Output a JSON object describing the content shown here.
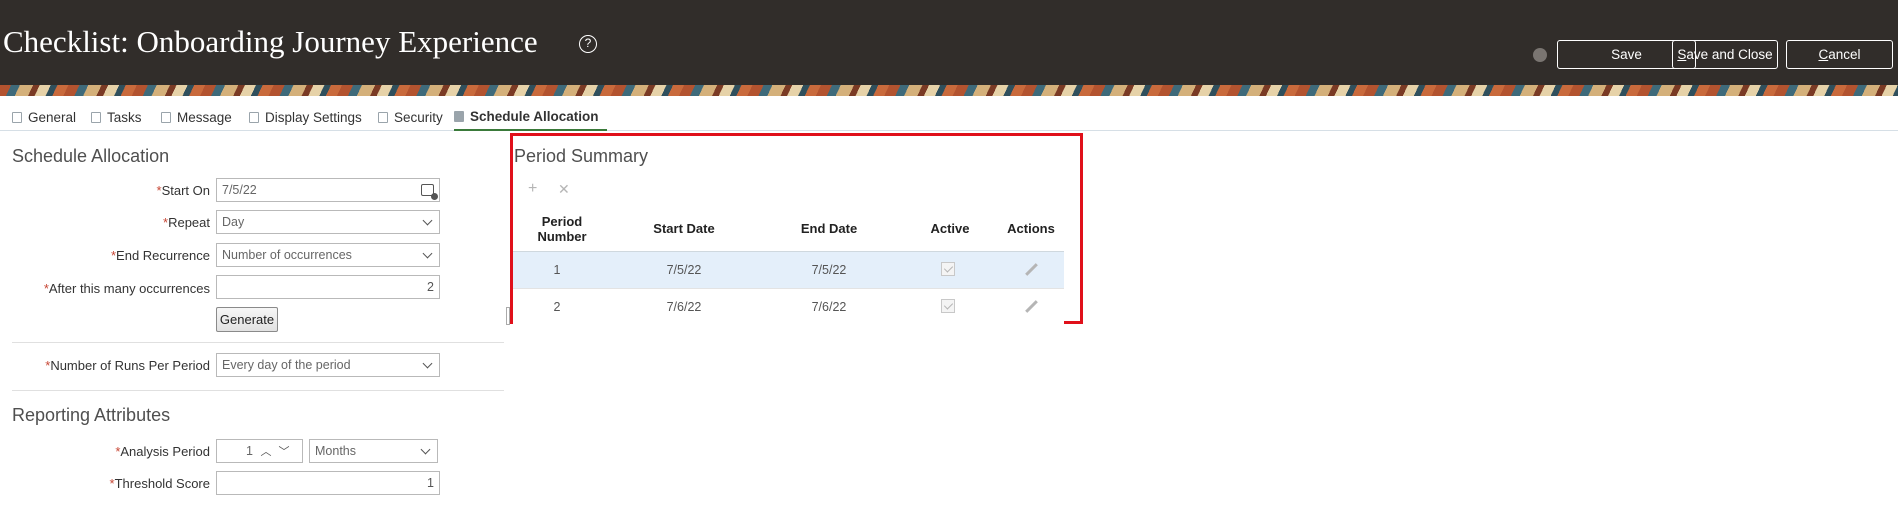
{
  "header": {
    "title": "Checklist: Onboarding Journey Experience",
    "help_icon": "?",
    "save_label": "Save",
    "save_close_label": "Save and Close",
    "cancel_label": "Cancel"
  },
  "tabs": [
    {
      "label": "General",
      "icon": "general-icon"
    },
    {
      "label": "Tasks",
      "icon": "tasks-icon"
    },
    {
      "label": "Message",
      "icon": "message-icon"
    },
    {
      "label": "Display Settings",
      "icon": "display-settings-icon"
    },
    {
      "label": "Security",
      "icon": "security-icon"
    },
    {
      "label": "Schedule Allocation",
      "icon": "calendar-icon",
      "active": true
    }
  ],
  "schedule": {
    "title": "Schedule Allocation",
    "required_mark": "*",
    "start_on_label": "Start On",
    "start_on_value": "7/5/22",
    "repeat_label": "Repeat",
    "repeat_value": "Day",
    "end_recurrence_label": "End Recurrence",
    "end_recurrence_value": "Number of occurrences",
    "after_label": "After this many occurrences",
    "after_value": "2",
    "generate_label": "Generate",
    "runs_label": "Number of Runs Per Period",
    "runs_value": "Every day of the period"
  },
  "reporting": {
    "title": "Reporting Attributes",
    "analysis_label": "Analysis Period",
    "analysis_value": "1",
    "analysis_unit": "Months",
    "threshold_label": "Threshold Score",
    "threshold_value": "1"
  },
  "period_summary": {
    "title": "Period Summary",
    "add_icon": "+",
    "delete_icon": "✕",
    "columns": [
      "Period Number",
      "Start Date",
      "End Date",
      "Active",
      "Actions"
    ],
    "rows": [
      {
        "period": "1",
        "start": "7/5/22",
        "end": "7/5/22",
        "active": true
      },
      {
        "period": "2",
        "start": "7/6/22",
        "end": "7/6/22",
        "active": true
      }
    ]
  }
}
